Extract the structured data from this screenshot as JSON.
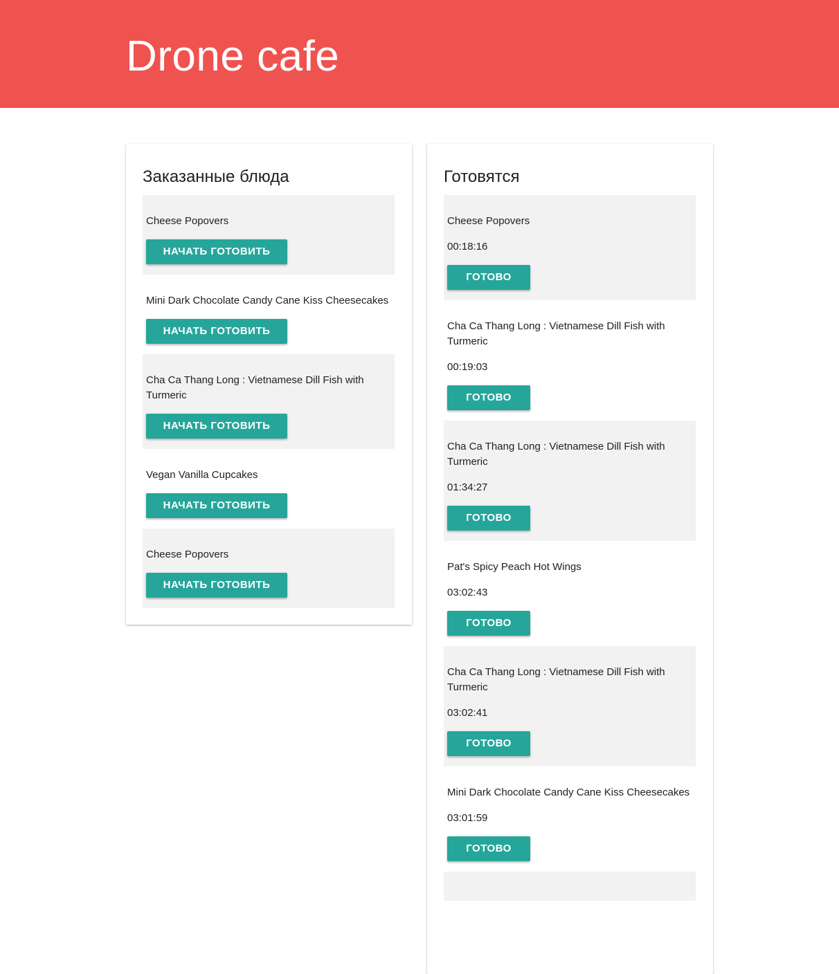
{
  "app": {
    "title": "Drone cafe",
    "colors": {
      "header": "#ef5350",
      "button": "#26a69a",
      "shaded_row": "#f2f2f2"
    }
  },
  "ordered": {
    "heading": "Заказанные блюда",
    "button_label": "НАЧАТЬ ГОТОВИТЬ",
    "items": [
      {
        "name": "Cheese Popovers"
      },
      {
        "name": "Mini Dark Chocolate Candy Cane Kiss Cheesecakes"
      },
      {
        "name": "Cha Ca Thang Long : Vietnamese Dill Fish with Turmeric"
      },
      {
        "name": "Vegan Vanilla Cupcakes"
      },
      {
        "name": "Cheese Popovers"
      }
    ]
  },
  "cooking": {
    "heading": "Готовятся",
    "button_label": "ГОТОВО",
    "items": [
      {
        "name": "Cheese Popovers",
        "timer": "00:18:16"
      },
      {
        "name": "Cha Ca Thang Long : Vietnamese Dill Fish with Turmeric",
        "timer": "00:19:03"
      },
      {
        "name": "Cha Ca Thang Long : Vietnamese Dill Fish with Turmeric",
        "timer": "01:34:27"
      },
      {
        "name": "Pat's Spicy Peach Hot Wings",
        "timer": "03:02:43"
      },
      {
        "name": "Cha Ca Thang Long : Vietnamese Dill Fish with Turmeric",
        "timer": "03:02:41"
      },
      {
        "name": "Mini Dark Chocolate Candy Cane Kiss Cheesecakes",
        "timer": "03:01:59"
      }
    ]
  }
}
